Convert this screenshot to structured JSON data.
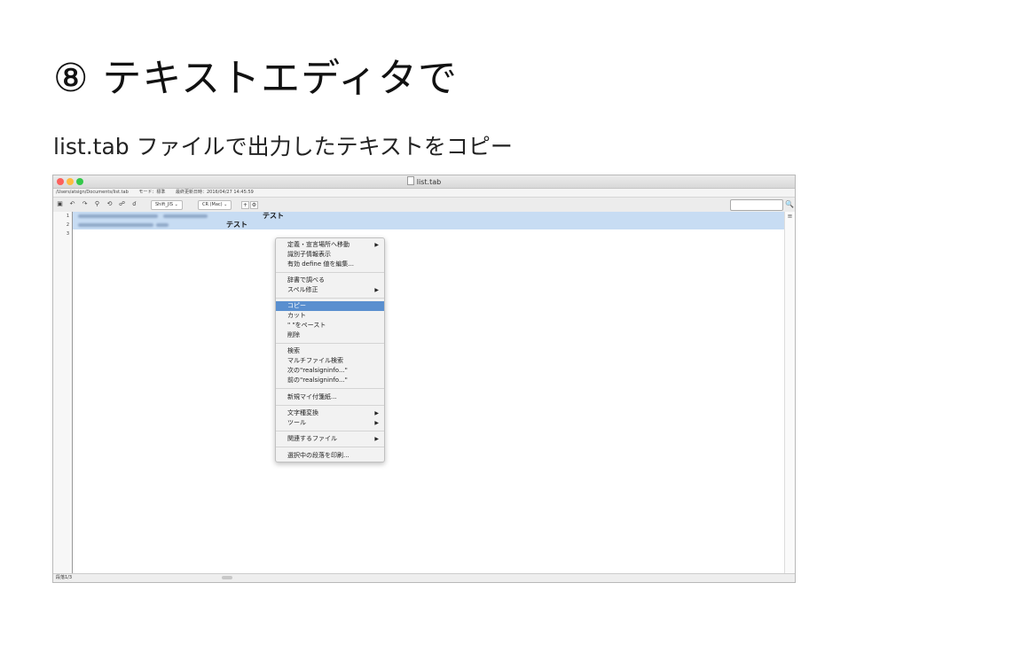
{
  "slide": {
    "title": "⑧ テキストエディタで",
    "subtitle": "list.tab ファイルで出力したテキストをコピー"
  },
  "window": {
    "title": "list.tab",
    "path": "/Users/atsign/Documents/list.tab",
    "mode": "モード：標準",
    "modified": "最終更新日時：2016/04/27 14:45:59"
  },
  "toolbar": {
    "icons": [
      "save-icon",
      "undo-icon",
      "redo-icon",
      "find-icon",
      "find-replace-icon",
      "search-multi-icon",
      "search-next-icon"
    ],
    "encoding": "Shift_JIS",
    "line_ending": "CR (Mac)",
    "plus_label": "+",
    "gear_label": "⚙",
    "search_glyph": "🔍"
  },
  "editor": {
    "line_numbers": [
      "1",
      "2",
      "3"
    ],
    "rows": [
      {
        "tail": "テスト"
      },
      {
        "tail": "テスト"
      }
    ],
    "scroll_icon": "≡"
  },
  "status": {
    "text": "段落1/3"
  },
  "context_menu": {
    "items": [
      {
        "label": "定義・宣言場所へ移動",
        "submenu": true
      },
      {
        "label": "識別子情報表示",
        "submenu": false
      },
      {
        "label": "有効 define 値を編集...",
        "submenu": false
      },
      {
        "label": "辞書で調べる",
        "submenu": false
      },
      {
        "label": "スペル修正",
        "submenu": true
      },
      {
        "label": "コピー",
        "submenu": false,
        "selected": true
      },
      {
        "label": "カット",
        "submenu": false
      },
      {
        "label": "\" \"をペースト",
        "submenu": false
      },
      {
        "label": "削除",
        "submenu": false
      },
      {
        "label": "検索",
        "submenu": false
      },
      {
        "label": "マルチファイル検索",
        "submenu": false
      },
      {
        "label": "次の\"realsigninfo...\"",
        "submenu": false
      },
      {
        "label": "前の\"realsigninfo...\"",
        "submenu": false
      },
      {
        "label": "新規マイ付箋紙...",
        "submenu": false
      },
      {
        "label": "文字種変換",
        "submenu": true
      },
      {
        "label": "ツール",
        "submenu": true
      },
      {
        "label": "関連するファイル",
        "submenu": true
      },
      {
        "label": "選択中の段落を印刷...",
        "submenu": false
      }
    ],
    "arrow_glyph": "▶"
  },
  "colors": {
    "selection": "#c7dcf3",
    "menu_highlight": "#5a8fcf"
  }
}
